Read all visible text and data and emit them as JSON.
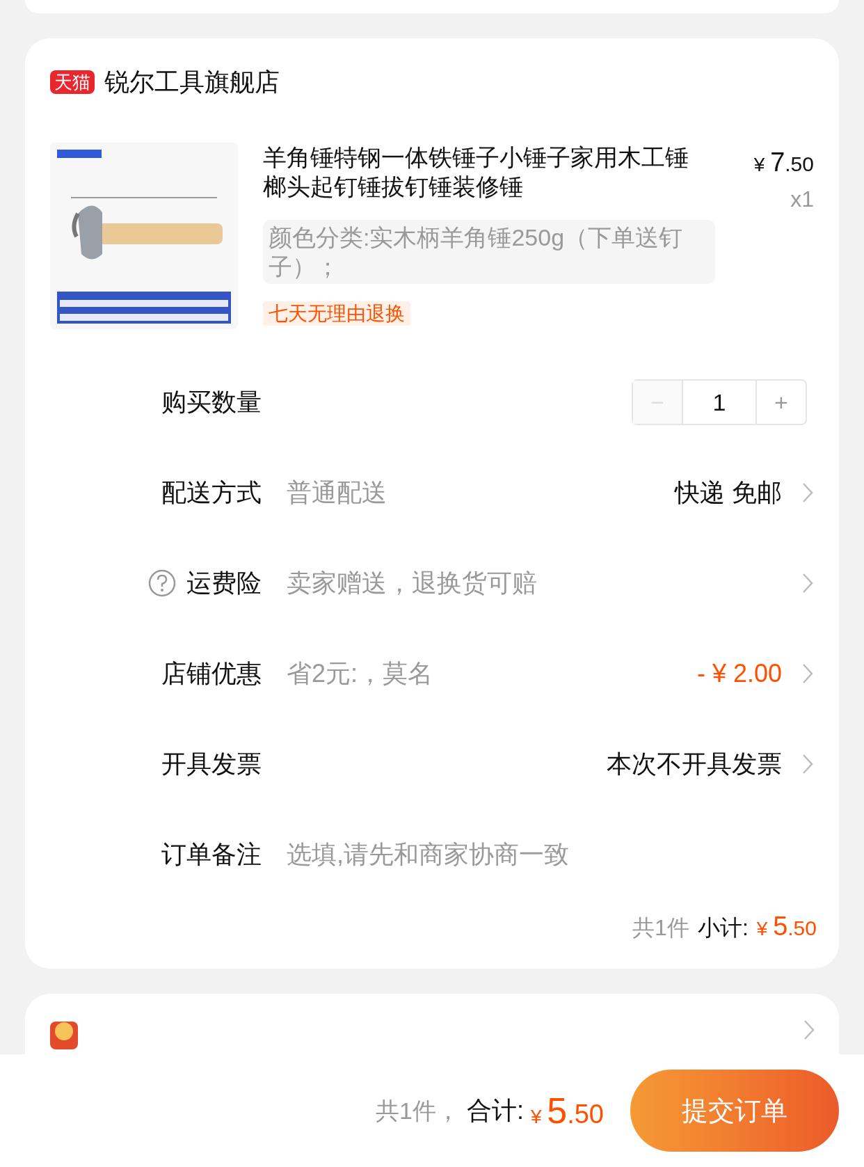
{
  "store": {
    "badge": "天猫",
    "name": "锐尔工具旗舰店"
  },
  "product": {
    "title": "羊角锤特钢一体铁锤子小锤子家用木工锤榔头起钉锤拔钉锤装修锤",
    "price_symbol": "¥",
    "price_int": "7",
    "price_dec": ".50",
    "quantity": "x1",
    "variant": "颜色分类:实木柄羊角锤250g（下单送钉子）；",
    "tag": "七天无理由退换"
  },
  "quantity_row": {
    "label": "购买数量",
    "value": "1",
    "minus_disabled": true,
    "plus_disabled": false,
    "minus": "−",
    "plus": "+"
  },
  "rows": [
    {
      "kind": "option",
      "label": "配送方式",
      "value": "普通配送",
      "detail": "快递 免邮"
    },
    {
      "kind": "help",
      "label": "运费险",
      "value": "卖家赠送，退换货可赔"
    },
    {
      "kind": "discount",
      "label": "店铺优惠",
      "value": "省2元:，莫名",
      "detail": "- ¥ 2.00"
    },
    {
      "kind": "option",
      "label": "开具发票",
      "detail": "本次不开具发票"
    },
    {
      "kind": "note",
      "label": "订单备注",
      "placeholder": "选填,请先和商家协商一致"
    }
  ],
  "subtotal": {
    "count": "共1件",
    "label": "小计:",
    "symbol": "¥",
    "int": "5",
    "dec": ".50"
  },
  "footer": {
    "count": "共1件，",
    "label": "合计:",
    "symbol": "¥",
    "int": "5",
    "dec": ".50",
    "submit": "提交订单"
  }
}
